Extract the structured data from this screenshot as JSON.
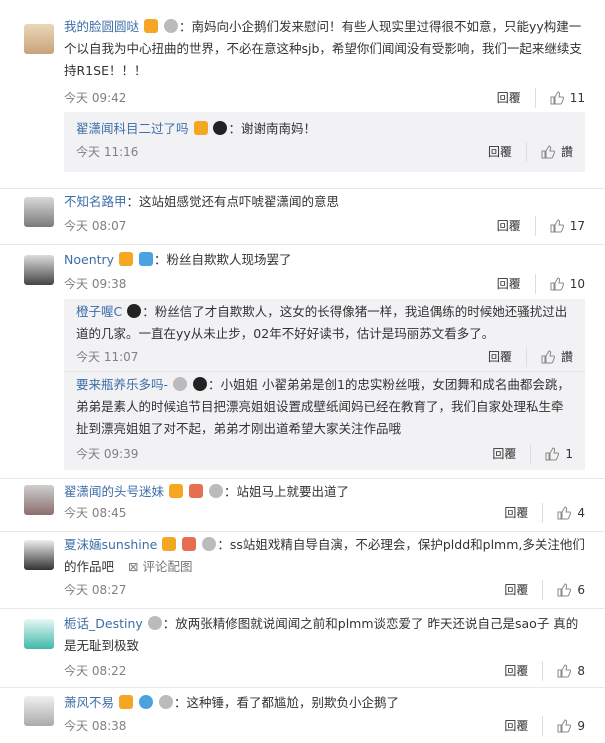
{
  "comments": [
    {
      "user": "我的脸圆圆哒",
      "text": "：南妈向小企鹅们发来慰问！有些人现实里过得很不如意，只能yy构建一个以自我为中心扭曲的世界，不必在意这种sjb，希望你们闻闻没有受影响，我们一起来继续支持R1SE！！！",
      "time": "今天 09:42",
      "reply": "回覆",
      "likes": "11"
    },
    {
      "user": "不知名路甲",
      "text": "：这站姐感觉还有点吓唬翟潇闻的意思",
      "time": "今天 08:07",
      "reply": "回覆",
      "likes": "17"
    },
    {
      "user": "Noentry",
      "text": "：粉丝自欺欺人现场罢了",
      "time": "今天 09:38",
      "reply": "回覆",
      "likes": "10"
    },
    {
      "user": "翟潇闻的头号迷妹",
      "text": "：站姐马上就要出道了",
      "time": "今天 08:45",
      "reply": "回覆",
      "likes": "4"
    },
    {
      "user": "夏沫婳sunshine",
      "text": "：ss站姐戏精自导自演，不必理会，保护pldd和plmm,多关注他们的作品吧",
      "pic": "评论配图",
      "time": "今天 08:27",
      "reply": "回覆",
      "likes": "6"
    },
    {
      "user": "栀话_Destiny",
      "text": "：放两张精修图就说闻闻之前和plmm谈恋爱了 昨天还说自己是sao子 真的是无耻到极致",
      "time": "今天 08:22",
      "reply": "回覆",
      "likes": "8"
    },
    {
      "user": "萧风不易",
      "text": "：这种锤，看了都尴尬，别欺负小企鹅了",
      "time": "今天 08:38",
      "reply": "回覆",
      "likes": "9"
    }
  ],
  "replies1": [
    {
      "user": "翟潇闻科目二过了吗",
      "text": "：谢谢南南妈！",
      "time": "今天 11:16",
      "reply": "回覆",
      "likes": "讚"
    }
  ],
  "replies3": [
    {
      "user": "橙子喔C",
      "text": "：粉丝信了才自欺欺人，这女的长得像猪一样，我追偶练的时候她还骚扰过出道的几家。一直在yy从未止步，02年不好好读书，估计是玛丽苏文看多了。",
      "time": "今天 11:07",
      "reply": "回覆",
      "likes": "讚"
    },
    {
      "user": "要来瓶养乐多吗-",
      "text": "：小姐姐 小翟弟弟是创1的忠实粉丝哦，女团舞和成名曲都会跳，弟弟是素人的时候追节目把漂亮姐姐设置成壁纸闻妈已经在教育了，我们自家处理私生牵扯到漂亮姐姐了对不起，弟弟才刚出道希望大家关注作品哦",
      "time": "今天 09:39",
      "reply": "回覆",
      "likes": "1"
    }
  ]
}
